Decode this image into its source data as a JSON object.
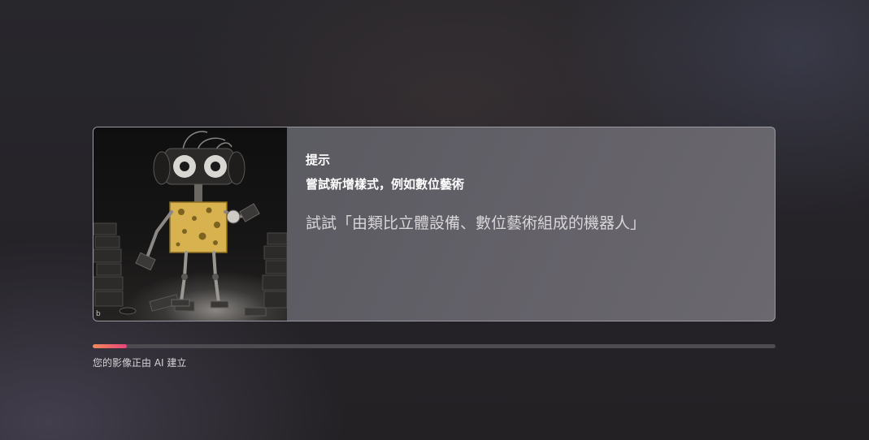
{
  "tip_card": {
    "heading": "提示",
    "subheading": "嘗試新增樣式，例如數位藝術",
    "example": "試試「由類比立體設備、數位藝術組成的機器人」",
    "image_icon": "robot-illustration",
    "watermark": "b"
  },
  "progress": {
    "fraction": 0.05,
    "status_text": "您的影像正由 AI 建立",
    "fill_colors": [
      "#f28a5a",
      "#e8427c"
    ]
  }
}
